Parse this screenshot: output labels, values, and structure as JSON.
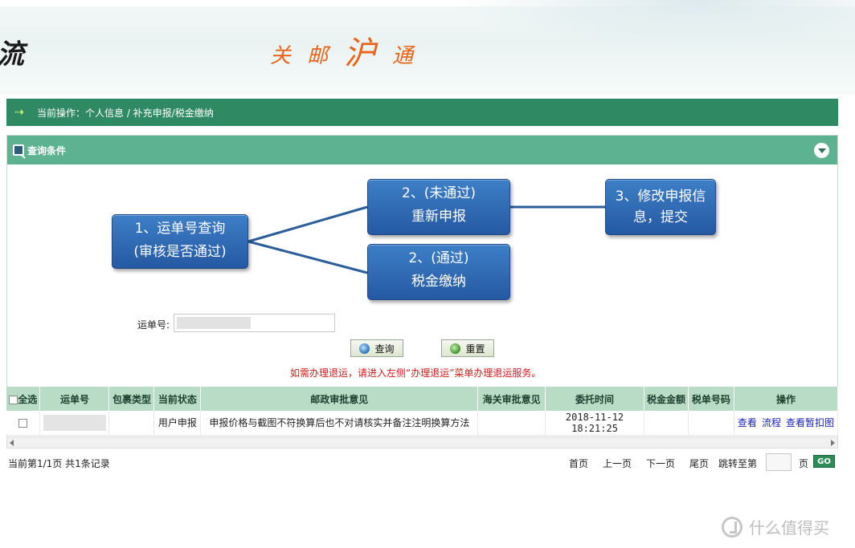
{
  "header": {
    "brand_fragment": "流",
    "slogan": [
      "关",
      "邮",
      "沪",
      "通"
    ]
  },
  "breadcrumb": {
    "text": "当前操作：个人信息 / 补充申报/税金缴纳"
  },
  "query_panel": {
    "title": "查询条件",
    "flow": {
      "step1_line1": "1、运单号查询",
      "step1_line2": "(审核是否通过)",
      "step2a_line1": "2、(未通过)",
      "step2a_line2": "重新申报",
      "step2b_line1": "2、(通过)",
      "step2b_line2": "税金缴纳",
      "step3_line1": "3、修改申报信",
      "step3_line2": "息，提交"
    },
    "waybill_label": "运单号:",
    "query_button": "查询",
    "reset_button": "重置",
    "notice": "如需办理退运，请进入左侧“办理退运”菜单办理退运服务。"
  },
  "table": {
    "headers": {
      "select_all": "全选",
      "waybill": "运单号",
      "parcel_type": "包裹类型",
      "status": "当前状态",
      "postal_opinion": "邮政审批意见",
      "customs_opinion": "海关审批意见",
      "entrust_time": "委托时间",
      "tax_amount": "税金金额",
      "tax_no": "税单号码",
      "actions": "操作"
    },
    "rows": [
      {
        "parcel_type": "",
        "status": "用户申报",
        "postal_opinion": "申报价格与截图不符换算后也不对请核实并备注注明换算方法",
        "customs_opinion": "",
        "entrust_time": "2018-11-12 18:21:25",
        "tax_amount": "",
        "tax_no": "",
        "action_view": "查看",
        "action_flow": "流程",
        "action_detain": "查看暂扣图"
      }
    ]
  },
  "pager": {
    "info": "当前第1/1页 共1条记录",
    "first": "首页",
    "prev": "上一页",
    "next": "下一页",
    "last": "尾页",
    "jump_to": "跳转至第",
    "page_unit": "页",
    "go": "GO"
  },
  "watermark": "什么值得买",
  "colors": {
    "crumb_bar": "#2f8a64",
    "panel_head": "#5db391",
    "table_head": "#b8dcc6",
    "flow_box": "#2b62ad",
    "notice": "#d21a1a",
    "link": "#1a24b8",
    "slogan": "#e8641b"
  }
}
